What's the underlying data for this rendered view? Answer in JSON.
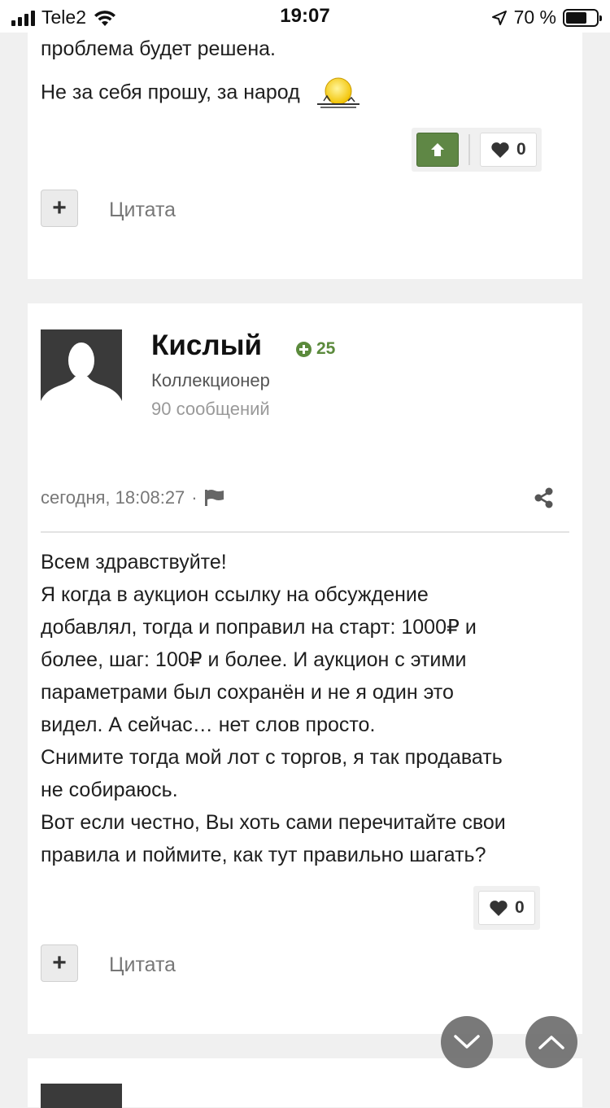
{
  "status_bar": {
    "carrier": "Tele2",
    "time": "19:07",
    "battery": "70 %",
    "battery_level": 0.7,
    "icons": [
      "signal-icon",
      "wifi-icon",
      "location-arrow-icon",
      "battery-icon"
    ]
  },
  "post_prev": {
    "lines": [
      "проблема будет решена.",
      "Не за себя прошу, за народ"
    ],
    "emoji": "sunset-emoji-icon",
    "likes": "0",
    "quote_label": "Цитата"
  },
  "post": {
    "author": "Кислый",
    "reputation": "25",
    "rank": "Коллекционер",
    "posts_count": "90 сообщений",
    "timestamp": "сегодня, 18:08:27",
    "separator": "·",
    "body_lines": [
      "Всем здравствуйте!",
      "Я когда в аукцион ссылку на обсуждение",
      "добавлял, тогда и поправил на старт: 1000₽ и",
      "более, шаг: 100₽ и более. И аукцион с этими",
      "параметрами был сохранён и не я один это",
      "видел. А сейчас… нет слов просто.",
      "Снимите тогда мой лот с торгов, я так продавать",
      "не собираюсь.",
      "Вот если честно, Вы хоть сами перечитайте свои",
      "правила и поймите, как тут правильно шагать?"
    ],
    "likes": "0",
    "quote_label": "Цитата"
  },
  "plus_symbol": "+",
  "colors": {
    "accent_green": "#5f8745",
    "reputation_green": "#5b8a3c",
    "background": "#f0f0f0",
    "card": "#ffffff"
  }
}
